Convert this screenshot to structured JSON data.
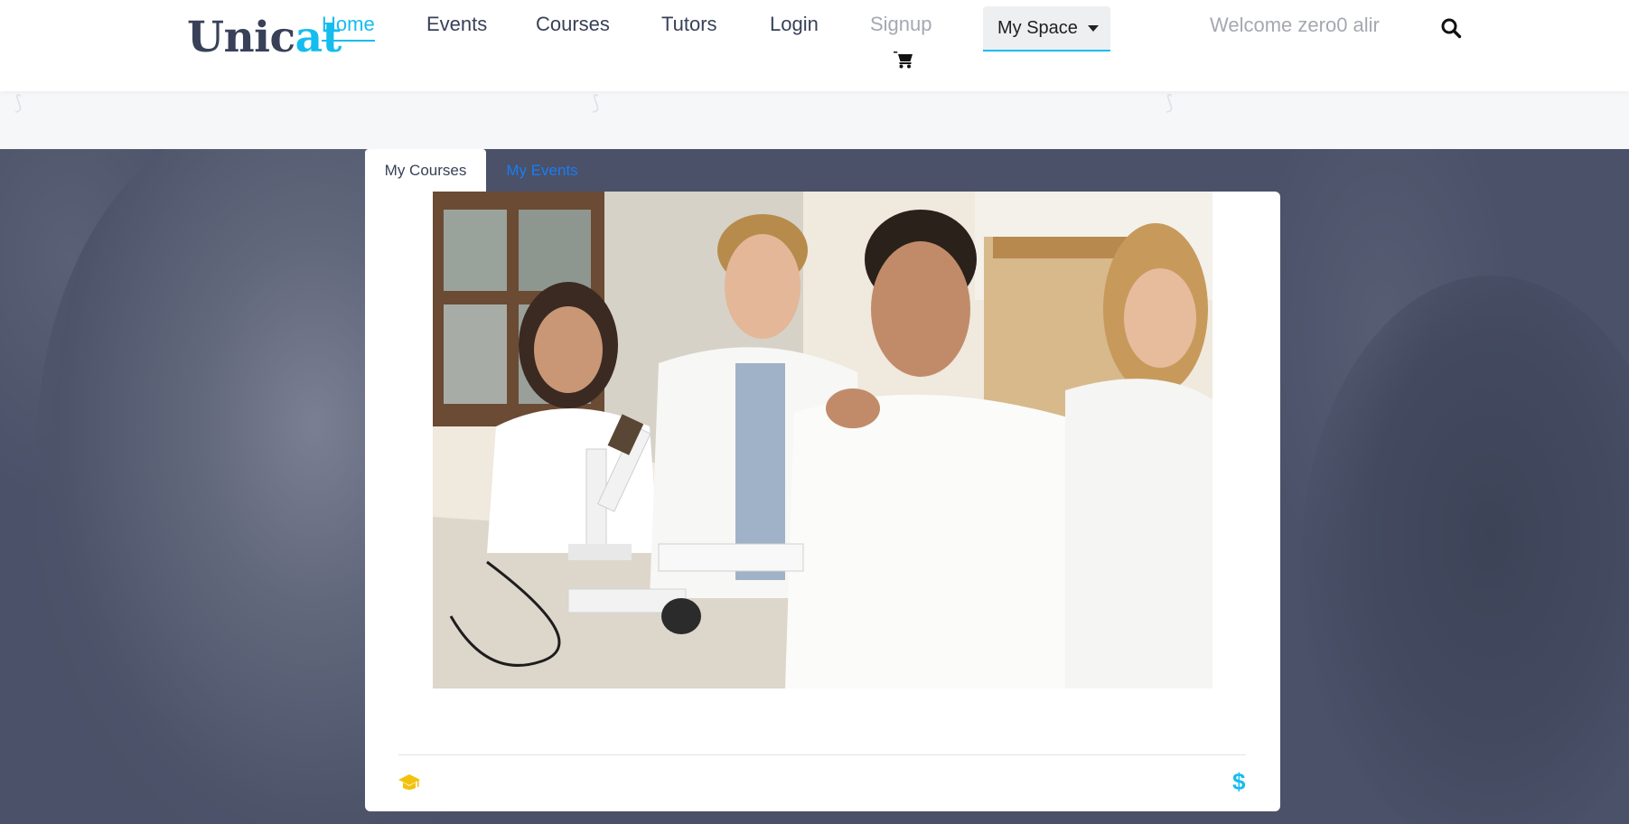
{
  "logo": {
    "part1": "Unic",
    "part2": "at"
  },
  "nav": {
    "home": "Home",
    "events": "Events",
    "courses": "Courses",
    "tutors": "Tutors",
    "login": "Login",
    "signup": "Signup"
  },
  "my_space": {
    "label": "My Space"
  },
  "welcome": "Welcome zero0 alir",
  "icons": {
    "cart": "cart-icon",
    "search": "search-icon",
    "caret": "caret-down-icon",
    "graduation": "graduation-cap-icon",
    "dollar": "dollar-icon"
  },
  "tabs": {
    "my_courses": "My Courses",
    "my_events": "My Events"
  },
  "course_card": {
    "image_alt": "Students in lab coats with microscopes",
    "price_symbol": "$"
  },
  "colors": {
    "brand_dark": "#384158",
    "accent": "#14bdee",
    "tab_link": "#1a7cf5",
    "hero_bg": "#4a5168",
    "icon_yellow": "#f2c20c",
    "muted": "#a5a8b0"
  }
}
